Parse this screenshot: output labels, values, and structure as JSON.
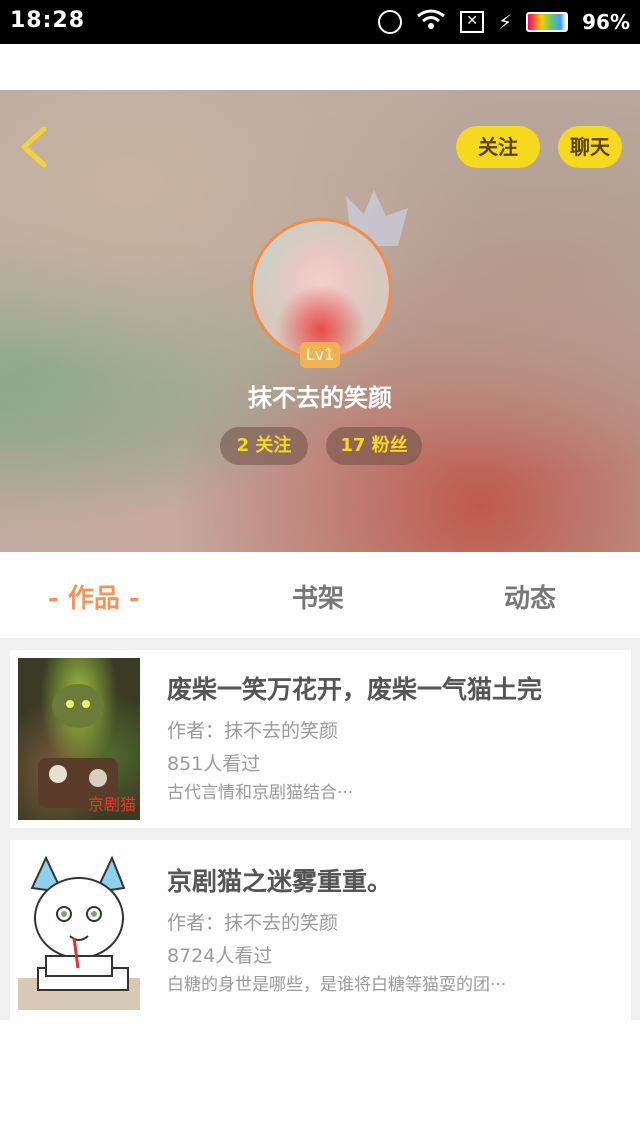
{
  "status_bar": {
    "time": "18:28",
    "battery_percent": "96%",
    "icons": [
      "alarm-icon",
      "wifi-icon",
      "sim-off-icon",
      "battery-icon"
    ]
  },
  "header": {
    "back_icon": "chevron-left-icon",
    "follow_label": "关注",
    "chat_label": "聊天",
    "level_badge": "Lv1",
    "username": "抹不去的笑颜",
    "following_stat": "2 关注",
    "fans_stat": "17 粉丝",
    "accent_color": "#f6d81e"
  },
  "tabs": {
    "works": "- 作品 -",
    "shelf": "书架",
    "dynamic": "动态",
    "active_color": "#f2935a"
  },
  "works": [
    {
      "title": "废柴一笑万花开，废柴一气猫土完",
      "author": "作者：抹不去的笑颜",
      "views": "851人看过",
      "description": "古代言情和京剧猫结合···",
      "cover_text": "京剧猫"
    },
    {
      "title": "京剧猫之迷雾重重。",
      "author": "作者：抹不去的笑颜",
      "views": "8724人看过",
      "description": "白糖的身世是哪些，是谁将白糖等猫耍的团···"
    }
  ]
}
